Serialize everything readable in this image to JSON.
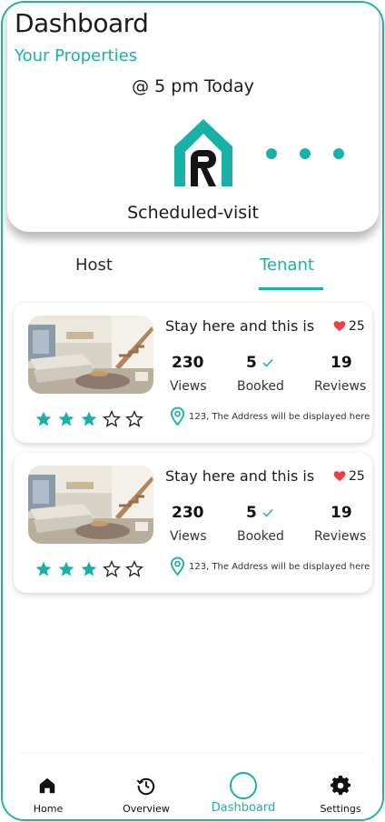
{
  "header": {
    "title": "Dashboard",
    "subtitle": "Your Properties"
  },
  "visit": {
    "time": "@ 5 pm Today",
    "label": "Scheduled-visit"
  },
  "tabs": [
    {
      "label": "Host",
      "active": false
    },
    {
      "label": "Tenant",
      "active": true
    }
  ],
  "properties": [
    {
      "name": "Stay here and this is",
      "likes": "25",
      "views": "230",
      "views_label": "Views",
      "booked": "5",
      "booked_label": "Booked",
      "reviews": "19",
      "reviews_label": "Reviews",
      "rating": 3,
      "rating_max": 5,
      "address": "123, The Address will be displayed here"
    },
    {
      "name": "Stay here and this is",
      "likes": "25",
      "views": "230",
      "views_label": "Views",
      "booked": "5",
      "booked_label": "Booked",
      "reviews": "19",
      "reviews_label": "Reviews",
      "rating": 3,
      "rating_max": 5,
      "address": "123, The Address will be displayed here"
    }
  ],
  "nav": [
    {
      "label": "Home",
      "icon": "home-icon"
    },
    {
      "label": "Overview",
      "icon": "history-icon"
    },
    {
      "label": "Dashboard",
      "icon": "avatar",
      "active": true
    },
    {
      "label": "Settings",
      "icon": "gear-icon"
    }
  ],
  "colors": {
    "accent": "#19b1a6",
    "heart": "#e8434b",
    "text": "#1c1c1c"
  }
}
